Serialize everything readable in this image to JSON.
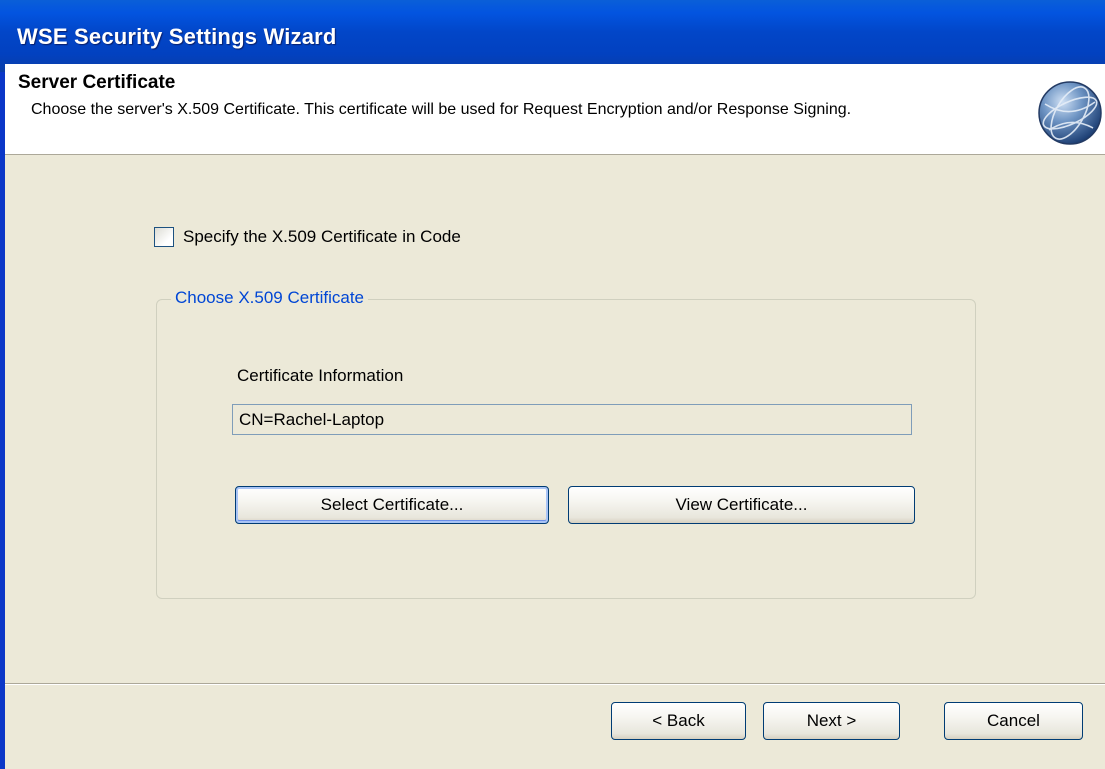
{
  "window": {
    "title": "WSE Security Settings Wizard"
  },
  "header": {
    "title": "Server Certificate",
    "description": "Choose the server's X.509 Certificate. This certificate will be used for Request Encryption and/or Response Signing.",
    "icon": "globe-icon"
  },
  "options": {
    "specify_in_code_label": "Specify the X.509 Certificate in Code",
    "specify_in_code_checked": false
  },
  "certificate_group": {
    "legend": "Choose X.509 Certificate",
    "info_label": "Certificate Information",
    "info_value": "CN=Rachel-Laptop",
    "select_button": "Select Certificate...",
    "view_button": "View Certificate..."
  },
  "footer": {
    "back_button": "< Back",
    "next_button": "Next >",
    "cancel_button": "Cancel"
  },
  "colors": {
    "titlebar": "#0246c8",
    "legend_text": "#0046d5",
    "dialog_background": "#ece9d8"
  }
}
